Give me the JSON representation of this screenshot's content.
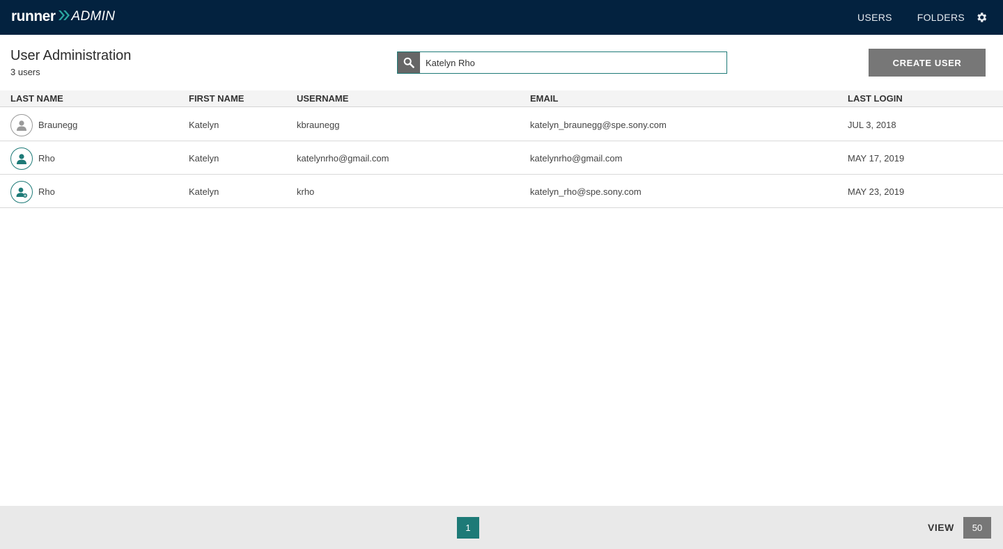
{
  "app": {
    "logo_primary": "runner",
    "logo_secondary": "ADMIN",
    "nav": [
      {
        "label": "USERS"
      },
      {
        "label": "FOLDERS"
      }
    ],
    "accent_color": "#1d7a77",
    "topbar_color": "#03223f"
  },
  "page": {
    "title": "User Administration",
    "count": "3 users"
  },
  "search": {
    "value": "Katelyn Rho",
    "icon": "search-icon"
  },
  "actions": {
    "create_label": "CREATE USER"
  },
  "table": {
    "columns": [
      "LAST NAME",
      "FIRST NAME",
      "USERNAME",
      "EMAIL",
      "LAST LOGIN"
    ],
    "rows": [
      {
        "last_name": "Braunegg",
        "first_name": "Katelyn",
        "username": "kbraunegg",
        "email": "katelyn_braunegg@spe.sony.com",
        "last_login": "JUL 3, 2018",
        "avatar": "user-inactive-icon"
      },
      {
        "last_name": "Rho",
        "first_name": "Katelyn",
        "username": "katelynrho@gmail.com",
        "email": "katelynrho@gmail.com",
        "last_login": "MAY 17, 2019",
        "avatar": "user-icon"
      },
      {
        "last_name": "Rho",
        "first_name": "Katelyn",
        "username": "krho",
        "email": "katelyn_rho@spe.sony.com",
        "last_login": "MAY 23, 2019",
        "avatar": "user-admin-icon"
      }
    ]
  },
  "pagination": {
    "current_page": "1",
    "view_label": "VIEW",
    "page_size": "50"
  }
}
